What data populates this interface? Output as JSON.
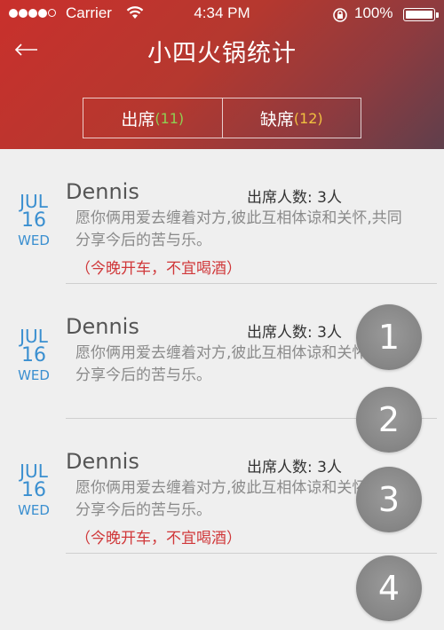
{
  "status_bar": {
    "carrier": "Carrier",
    "time": "4:34 PM",
    "battery": "100%"
  },
  "header": {
    "title": "小四火锅统计",
    "back_icon": "back-arrow-icon",
    "tabs": [
      {
        "label": "出席",
        "count": "(11)",
        "count_color": "#8fce53"
      },
      {
        "label": "缺席",
        "count": "(12)",
        "count_color": "#f0c040"
      }
    ]
  },
  "items": [
    {
      "month": "JUL",
      "day": "16",
      "weekday": "WED",
      "name": "Dennis",
      "attendance": "出席人数: 3人",
      "message": "愿你俩用爱去缠着对方,彼此互相体谅和关怀,共同分享今后的苦与乐。",
      "note": "（今晚开车，不宜喝酒）"
    },
    {
      "month": "JUL",
      "day": "16",
      "weekday": "WED",
      "name": "Dennis",
      "attendance": "出席人数: 3人",
      "message": "愿你俩用爱去缠着对方,彼此互相体谅和关怀,共同分享今后的苦与乐。",
      "note": ""
    },
    {
      "month": "JUL",
      "day": "16",
      "weekday": "WED",
      "name": "Dennis",
      "attendance": "出席人数: 3人",
      "message": "愿你俩用爱去缠着对方,彼此互相体谅和关怀,共同分享今后的苦与乐。",
      "note": "（今晚开车，不宜喝酒）"
    }
  ],
  "circles": [
    "1",
    "2",
    "3",
    "4"
  ]
}
